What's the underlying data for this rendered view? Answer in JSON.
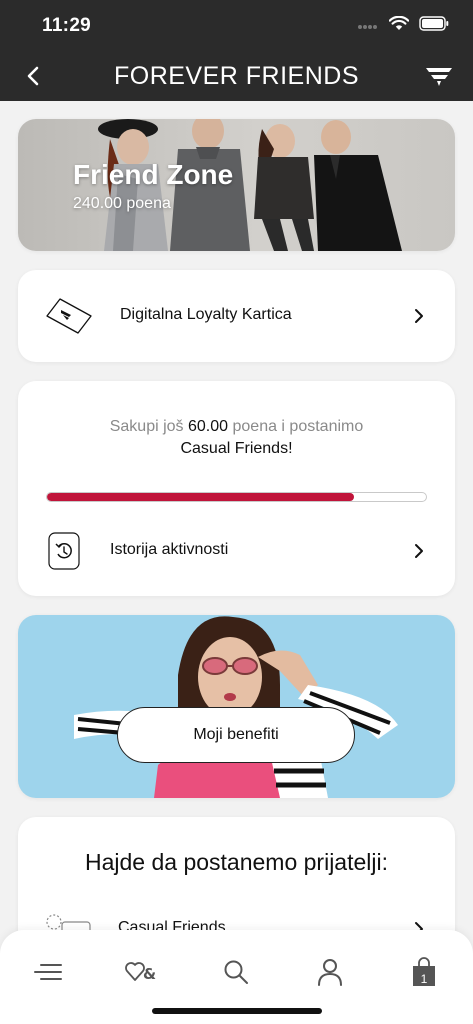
{
  "status_bar": {
    "time": "11:29"
  },
  "nav": {
    "title": "FOREVER FRIENDS"
  },
  "hero": {
    "title": "Friend Zone",
    "points": "240.00 poena"
  },
  "loyalty_card": {
    "label": "Digitalna Loyalty Kartica"
  },
  "progress": {
    "prefix": "Sakupi još ",
    "points": "60.00",
    "suffix": " poena i postanimo",
    "tier": "Casual Friends!",
    "fill_percent": 81
  },
  "history": {
    "label": "Istorija aktivnosti"
  },
  "benefits": {
    "button_label": "Moji benefiti"
  },
  "friends": {
    "title": "Hajde da postanemo prijatelji:",
    "first_item": "Casual Friends"
  },
  "tabbar": {
    "items": [
      "menu-icon",
      "wishlist-icon",
      "search-icon",
      "profile-icon",
      "bag-icon"
    ],
    "bag_count": "1"
  },
  "colors": {
    "header": "#2b2b2b",
    "accent": "#c0143a",
    "benefits_bg": "#9ed4ec"
  }
}
